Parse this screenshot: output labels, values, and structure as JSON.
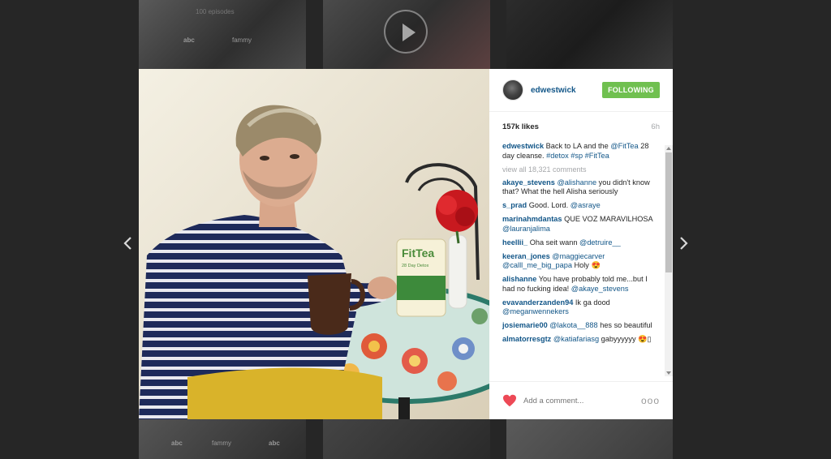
{
  "background": {
    "tiles": [
      {
        "caption": "100 episodes"
      },
      {
        "caption": ""
      },
      {
        "caption": ""
      }
    ],
    "logos": [
      "abc",
      "fammy",
      "abc",
      "fammy",
      "abc"
    ]
  },
  "nav": {
    "prev_icon": "chevron-left-icon",
    "next_icon": "chevron-right-icon"
  },
  "post": {
    "photo_text": {
      "brand": "FitTea",
      "sub1": "28 Day Detox"
    }
  },
  "header": {
    "username": "edwestwick",
    "follow_label": "FOLLOWING",
    "follow_color": "#70c050"
  },
  "stats": {
    "likes": "157k likes",
    "time": "6h"
  },
  "caption": {
    "user": "edwestwick",
    "text_pre": " Back to LA and the ",
    "mention": "@FitTea",
    "text_post": " 28 day cleanse. ",
    "tags": "#detox #sp #FitTea"
  },
  "view_all": "view all 18,321 comments",
  "comments": [
    {
      "user": "akaye_stevens",
      "mention": "@alishanne",
      "text": " you didn't know that? What the hell Alisha seriously"
    },
    {
      "user": "s_prad",
      "mention": "",
      "text": " Good. Lord. ",
      "mention2": "@asraye"
    },
    {
      "user": "marinahmdantas",
      "mention": "",
      "text": " QUE VOZ MARAVILHOSA ",
      "mention2": "@lauranjalima"
    },
    {
      "user": "heellii_",
      "mention": "",
      "text": " Oha seit wann ",
      "mention2": "@detruire__"
    },
    {
      "user": "keeran_jones",
      "mention": "@maggiecarver",
      "text": " ",
      "mention2": "@calll_me_big_papa",
      "text2": " Holy 😍"
    },
    {
      "user": "alishanne",
      "mention": "",
      "text": " You have probably told me...but I had no fucking idea! ",
      "mention2": "@akaye_stevens"
    },
    {
      "user": "evavanderzanden94",
      "mention": "",
      "text": " Ik ga dood ",
      "mention2": "@meganwennekers"
    },
    {
      "user": "josiemarie00",
      "mention": "@lakota__888",
      "text": " hes so beautiful"
    },
    {
      "user": "almatorresgtz",
      "mention": "@katiafariasg",
      "text": " gabyyyyyy 😍▯"
    }
  ],
  "footer": {
    "like_icon": "heart-icon",
    "like_color": "#ed4956",
    "comment_placeholder": "Add a comment...",
    "more_icon": "more-options-icon",
    "more_glyph": "ooo"
  }
}
